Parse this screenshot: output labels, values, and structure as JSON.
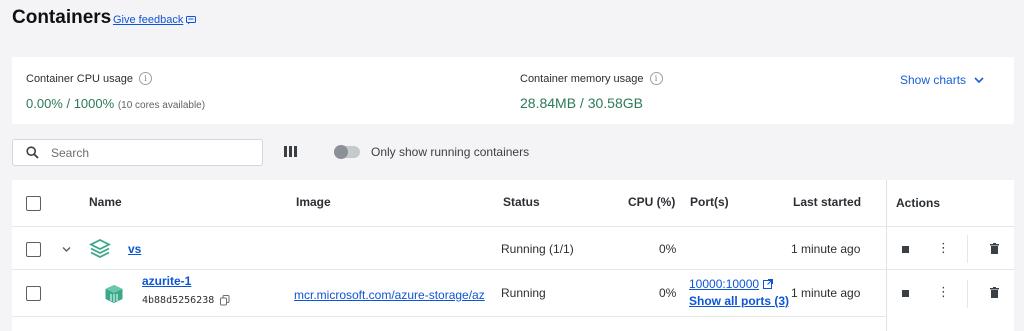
{
  "header": {
    "title": "Containers",
    "feedback_label": "Give feedback"
  },
  "stats": {
    "cpu": {
      "label": "Container CPU usage",
      "value": "0.00% / 1000%",
      "note": "(10 cores available)"
    },
    "memory": {
      "label": "Container memory usage",
      "value": "28.84MB / 30.58GB"
    },
    "show_charts_label": "Show charts"
  },
  "toolbar": {
    "search_placeholder": "Search",
    "toggle_label": "Only show running containers",
    "toggle_on": false
  },
  "table": {
    "columns": [
      "Name",
      "Image",
      "Status",
      "CPU (%)",
      "Port(s)",
      "Last started",
      "Actions"
    ],
    "rows": [
      {
        "name": "vs",
        "image": "",
        "status": "Running (1/1)",
        "cpu": "0%",
        "port": "",
        "last_started": "1 minute ago",
        "type": "group"
      },
      {
        "name": "azurite-1",
        "id": "4b88d5256238",
        "image": "mcr.microsoft.com/azure-storage/az",
        "status": "Running",
        "cpu": "0%",
        "port": "10000:10000",
        "ports_link": "Show all ports (3)",
        "last_started": "1 minute ago",
        "type": "container"
      }
    ]
  },
  "colors": {
    "accent": "#0d55d6",
    "stat_green": "#2c7a57",
    "icon_teal": "#3aa88a"
  }
}
